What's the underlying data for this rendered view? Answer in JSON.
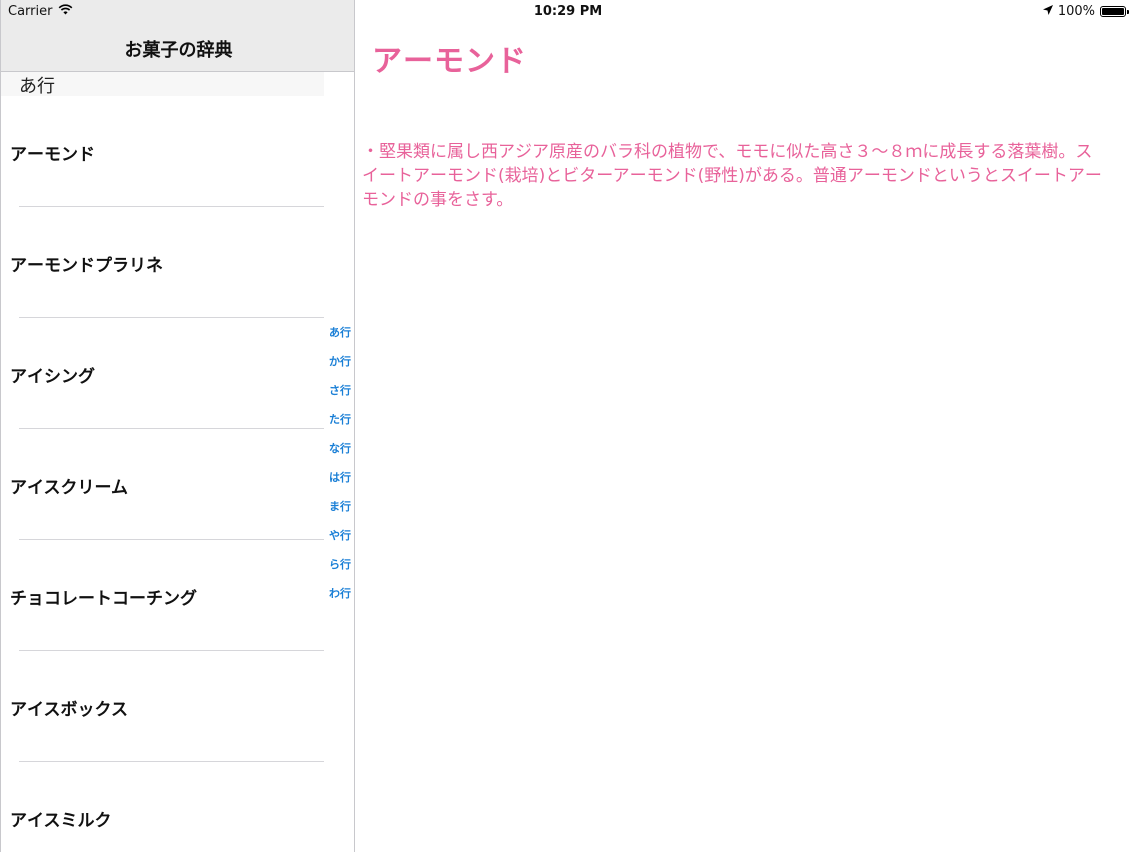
{
  "status_bar": {
    "carrier": "Carrier",
    "time": "10:29 PM",
    "battery": "100%",
    "battery_level": 1.0
  },
  "master": {
    "title": "お菓子の辞典",
    "section_header": "あ行",
    "items": [
      {
        "label": "アーモンド"
      },
      {
        "label": "アーモンドプラリネ"
      },
      {
        "label": "アイシング"
      },
      {
        "label": "アイスクリーム"
      },
      {
        "label": "チョコレートコーチング"
      },
      {
        "label": "アイスボックス"
      },
      {
        "label": "アイスミルク"
      }
    ],
    "index": [
      "あ行",
      "か行",
      "さ行",
      "た行",
      "な行",
      "は行",
      "ま行",
      "や行",
      "ら行",
      "わ行"
    ]
  },
  "detail": {
    "title": "アーモンド",
    "body": "・堅果類に属し西アジア原産のバラ科の植物で、モモに似た高さ３～８ｍに成長する落葉樹。スイートアーモンド(栽培)とビターアーモンド(野性)がある。普通アーモンドというとスイートアーモンドの事をさす。"
  },
  "colors": {
    "accent_pink": "#e8629a",
    "index_blue": "#1a7fd6",
    "nav_bg": "#ebebeb"
  }
}
